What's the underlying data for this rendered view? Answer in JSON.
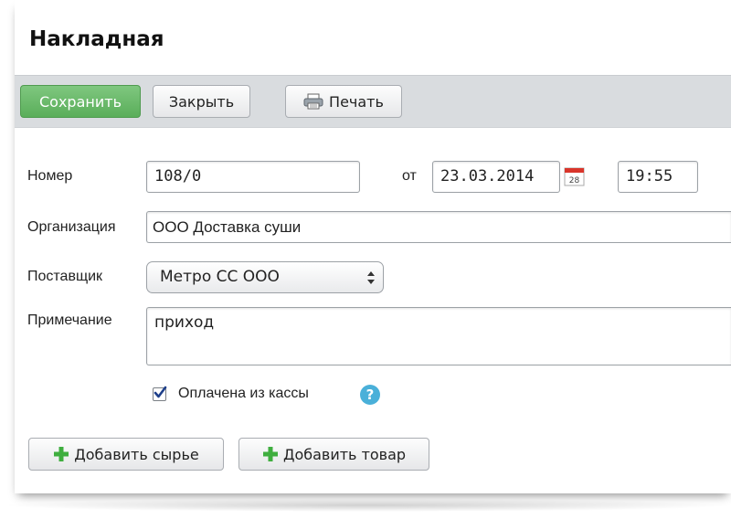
{
  "header": {
    "title": "Накладная"
  },
  "toolbar": {
    "save_label": "Сохранить",
    "close_label": "Закрыть",
    "print_label": "Печать"
  },
  "form": {
    "number": {
      "label": "Номер",
      "value": "108/0"
    },
    "date": {
      "from_label": "от",
      "value": "23.03.2014",
      "calendar_icon_day": "28"
    },
    "time": {
      "value": "19:55"
    },
    "organization": {
      "label": "Организация",
      "value": "ООО Доставка суши"
    },
    "supplier": {
      "label": "Поставщик",
      "selected": "Метро СС ООО"
    },
    "note": {
      "label": "Примечание",
      "value": "приход"
    },
    "paid": {
      "label": "Оплачена из кассы",
      "checked": true,
      "help_icon": "question-mark"
    }
  },
  "actions": {
    "add_raw_label": "Добавить сырье",
    "add_goods_label": "Добавить товар"
  },
  "colors": {
    "save_button": "#5aae5a",
    "toolbar_bg": "#d9dcdf",
    "plus_icon": "#3fae3f",
    "help_icon": "#4ab0d9",
    "calendar_accent": "#d9352b"
  }
}
